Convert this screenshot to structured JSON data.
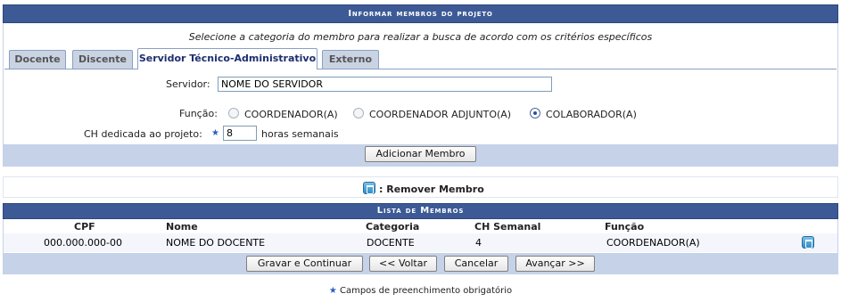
{
  "form": {
    "title": "Informar membros do projeto",
    "subtitle": "Selecione a categoria do membro para realizar a busca de acordo com os critérios específicos",
    "tabs": [
      {
        "label": "Docente"
      },
      {
        "label": "Discente"
      },
      {
        "label": "Servidor Técnico-Administrativo"
      },
      {
        "label": "Externo"
      }
    ],
    "active_tab": "Servidor Técnico-Administrativo",
    "servidor_label": "Servidor:",
    "servidor_value": "NOME DO SERVIDOR",
    "funcao_label": "Função:",
    "funcao_options": [
      {
        "label": "COORDENADOR(A)",
        "checked": false
      },
      {
        "label": "COORDENADOR ADJUNTO(A)",
        "checked": false
      },
      {
        "label": "COLABORADOR(A)",
        "checked": true
      }
    ],
    "ch_label": "CH dedicada ao projeto:",
    "ch_value": "8",
    "ch_suffix": "horas semanais",
    "add_button": "Adicionar Membro",
    "required_star": "★"
  },
  "legend": {
    "label": ": Remover Membro",
    "icon": "trash-icon"
  },
  "members": {
    "title": "Lista de Membros",
    "columns": [
      "CPF",
      "Nome",
      "Categoria",
      "CH Semanal",
      "Função"
    ],
    "rows": [
      {
        "cpf": "000.000.000-00",
        "nome": "NOME DO DOCENTE",
        "categoria": "DOCENTE",
        "ch": "4",
        "funcao": "COORDENADOR(A)"
      }
    ]
  },
  "actions": {
    "save": "Gravar e Continuar",
    "back": "<< Voltar",
    "cancel": "Cancelar",
    "next": "Avançar >>"
  },
  "footnote": "Campos de preenchimento obrigatório",
  "colors": {
    "header": "#3d5a96",
    "bar": "#c6d2e8",
    "star": "#2e5fbf"
  }
}
